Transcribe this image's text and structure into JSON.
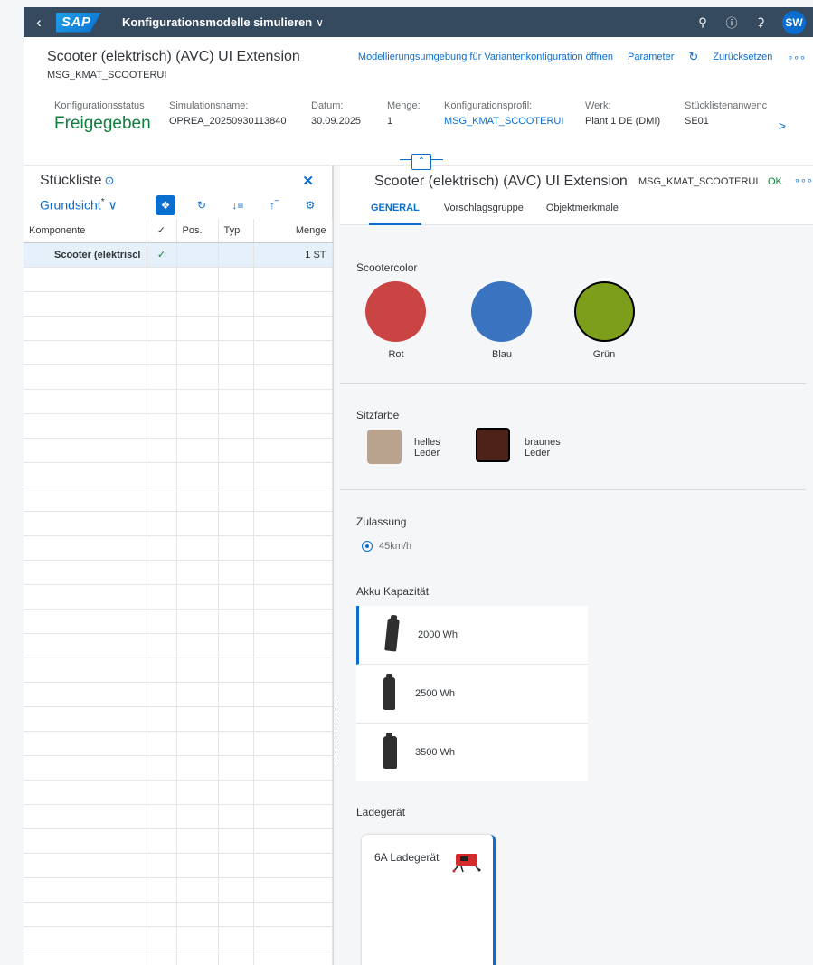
{
  "shell": {
    "back": "‹",
    "logo": "SAP",
    "title": "Konfigurationsmodelle simulieren",
    "avatar": "SW"
  },
  "header": {
    "title": "Scooter (elektrisch) (AVC) UI Extension",
    "subtitle": "MSG_KMAT_SCOOTERUI",
    "actions": {
      "modeling": "Modellierungsumgebung für Variantenkonfiguration öffnen",
      "parameter": "Parameter",
      "reset": "Zurücksetzen"
    },
    "attributes": [
      {
        "label": "Konfigurationsstatus",
        "value": "Freigegeben"
      },
      {
        "label": "Simulationsname:",
        "value": "OPREA_20250930113840"
      },
      {
        "label": "Datum:",
        "value": "30.09.2025"
      },
      {
        "label": "Menge:",
        "value": "1"
      },
      {
        "label": "Konfigurationsprofil:",
        "value": "MSG_KMAT_SCOOTERUI"
      },
      {
        "label": "Werk:",
        "value": "Plant 1 DE (DMI)"
      },
      {
        "label": "Stücklistenanwenc",
        "value": "SE01"
      }
    ]
  },
  "bom": {
    "title": "Stückliste",
    "view": "Grundsicht",
    "view_marker": "*",
    "columns": [
      "Komponente",
      "✓",
      "Pos.",
      "Typ",
      "Menge"
    ],
    "rows": [
      {
        "component": "Scooter (elektriscl",
        "check": "✓",
        "pos": "",
        "typ": "",
        "qty": "1 ST"
      }
    ]
  },
  "config": {
    "title": "Scooter (elektrisch) (AVC) UI Extension",
    "code": "MSG_KMAT_SCOOTERUI",
    "status": "OK",
    "tabs": [
      "GENERAL",
      "Vorschlagsgruppe",
      "Objektmerkmale"
    ],
    "scootercolor": {
      "label": "Scootercolor",
      "options": [
        {
          "label": "Rot",
          "color": "#cb4444",
          "selected": false
        },
        {
          "label": "Blau",
          "color": "#3a73bf",
          "selected": false
        },
        {
          "label": "Grün",
          "color": "#7d9e1a",
          "selected": true
        }
      ]
    },
    "sitzfarbe": {
      "label": "Sitzfarbe",
      "options": [
        {
          "label_line1": "helles",
          "label_line2": "Leder",
          "color": "#b9a38f",
          "selected": false
        },
        {
          "label_line1": "braunes",
          "label_line2": "Leder",
          "color": "#4e2218",
          "selected": true
        }
      ]
    },
    "zulassung": {
      "label": "Zulassung",
      "option": "45km/h"
    },
    "akku": {
      "label": "Akku Kapazität",
      "options": [
        {
          "label": "2000 Wh",
          "selected": true
        },
        {
          "label": "2500 Wh",
          "selected": false
        },
        {
          "label": "3500 Wh",
          "selected": false
        }
      ]
    },
    "ladegeraet": {
      "label": "Ladegerät",
      "option": "6A Ladegerät"
    }
  }
}
